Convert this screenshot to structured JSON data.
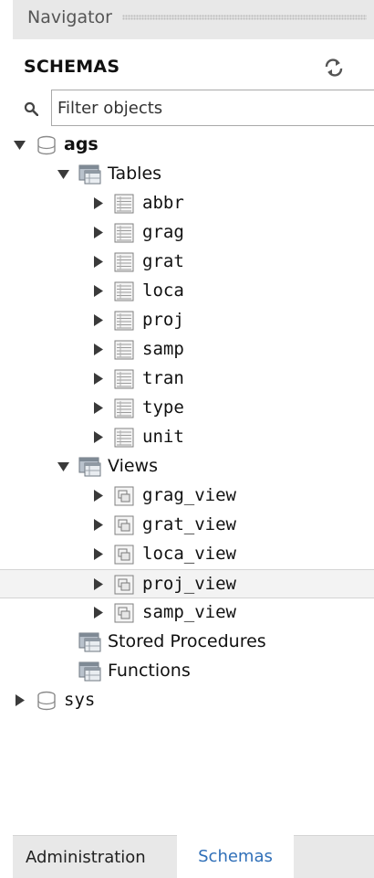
{
  "navigator": {
    "title": "Navigator"
  },
  "schemas": {
    "title": "SCHEMAS",
    "refresh_icon": "refresh-arrows-icon",
    "filter_placeholder": "Filter objects",
    "search_icon": "magnifier-icon"
  },
  "tree": {
    "nodes": [
      {
        "label": "ags",
        "kind": "schema",
        "state": "expanded",
        "bold": true
      },
      {
        "label": "Tables",
        "kind": "group",
        "state": "expanded"
      },
      {
        "label": "abbr",
        "kind": "table",
        "state": "collapsed"
      },
      {
        "label": "grag",
        "kind": "table",
        "state": "collapsed"
      },
      {
        "label": "grat",
        "kind": "table",
        "state": "collapsed"
      },
      {
        "label": "loca",
        "kind": "table",
        "state": "collapsed"
      },
      {
        "label": "proj",
        "kind": "table",
        "state": "collapsed"
      },
      {
        "label": "samp",
        "kind": "table",
        "state": "collapsed"
      },
      {
        "label": "tran",
        "kind": "table",
        "state": "collapsed"
      },
      {
        "label": "type",
        "kind": "table",
        "state": "collapsed"
      },
      {
        "label": "unit",
        "kind": "table",
        "state": "collapsed"
      },
      {
        "label": "Views",
        "kind": "group",
        "state": "expanded"
      },
      {
        "label": "grag_view",
        "kind": "view",
        "state": "collapsed"
      },
      {
        "label": "grat_view",
        "kind": "view",
        "state": "collapsed"
      },
      {
        "label": "loca_view",
        "kind": "view",
        "state": "collapsed"
      },
      {
        "label": "proj_view",
        "kind": "view",
        "state": "collapsed",
        "selected": true
      },
      {
        "label": "samp_view",
        "kind": "view",
        "state": "collapsed"
      },
      {
        "label": "Stored Procedures",
        "kind": "group",
        "state": "none"
      },
      {
        "label": "Functions",
        "kind": "group",
        "state": "none"
      },
      {
        "label": "sys",
        "kind": "schema",
        "state": "collapsed",
        "bold": false
      }
    ]
  },
  "tabs": {
    "administration": "Administration",
    "schemas": "Schemas",
    "active": "Schemas"
  },
  "colors": {
    "header_bg": "#e8e8e8",
    "selected_row": "#f3f3f3",
    "active_tab_text": "#2f6fb8",
    "arrow": "#3a3a3a"
  }
}
